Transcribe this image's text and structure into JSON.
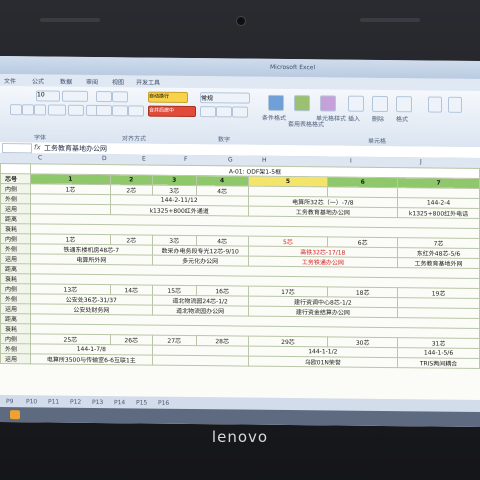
{
  "window_title": "Microsoft Excel",
  "menu": [
    "文件",
    "公式",
    "数据",
    "审阅",
    "视图",
    "开发工具"
  ],
  "ribbon": {
    "groups": [
      "字体",
      "对齐方式",
      "数字",
      "单元格"
    ],
    "font_size": "10",
    "number_format": "常规",
    "wrap_button": "自动换行",
    "merge_button": "合并后居中",
    "buttons": [
      "条件格式",
      "套用表格格式",
      "单元格样式",
      "插入",
      "删除",
      "格式"
    ]
  },
  "formula_bar": {
    "fx": "fx",
    "content": "工务教育基地办公网"
  },
  "columns": [
    "C",
    "D",
    "E",
    "F",
    "G",
    "H",
    "I",
    "J"
  ],
  "table": {
    "title": "A-01: ODF架1-5框",
    "header_label": "芯号",
    "header_nums": [
      "1",
      "2",
      "3",
      "4",
      "5",
      "6",
      "7"
    ],
    "blocks": [
      {
        "row_labels": [
          "内侧",
          "外侧",
          "运用",
          "距离",
          "衰耗"
        ],
        "inner": [
          "1芯",
          "2芯",
          "3芯",
          "4芯",
          "",
          "",
          ""
        ],
        "outer": [
          "144-2-11/12",
          "电算所32芯（一）-7/8",
          "144-2-4"
        ],
        "use": [
          "k1325+800红外通道",
          "工务教育基地办公网",
          "k1325+800红外电话"
        ]
      },
      {
        "row_labels": [
          "内侧",
          "外侧",
          "运用",
          "距离",
          "衰耗"
        ],
        "inner": [
          "1芯",
          "2芯",
          "3芯",
          "4芯",
          "5芯",
          "6芯",
          "7芯"
        ],
        "outer": [
          "铁通东楼机房48芯-7",
          "数采办电务段专光12芯-9/10",
          "高铁32芯-17/18",
          "东红外48芯-5/6"
        ],
        "use": [
          "电算所外网",
          "多元化办公网",
          "工务铁通办公网",
          "工务教育基地外网"
        ]
      },
      {
        "row_labels": [
          "内侧",
          "外侧",
          "运用",
          "距离",
          "衰耗"
        ],
        "inner": [
          "13芯",
          "14芯",
          "15芯",
          "16芯",
          "17芯",
          "18芯",
          "19芯"
        ],
        "outer": [
          "公安处36芯-31/37",
          "道北物流园24芯-1/2",
          "建行资调中心8芯-1/2"
        ],
        "use": [
          "公安处财务网",
          "道北物流园办公网",
          "建行资金结算办公网"
        ]
      },
      {
        "row_labels": [
          "内侧",
          "外侧",
          "运用"
        ],
        "inner": [
          "25芯",
          "26芯",
          "27芯",
          "28芯",
          "29芯",
          "30芯",
          "31芯"
        ],
        "outer": [
          "144-1-7/8",
          "144-1-1/2",
          "144-1-5/6"
        ],
        "use": [
          "电算所3500与传输室6-6互联1主",
          "乌欧01N荣誉",
          "TRIS两间耦合"
        ]
      }
    ]
  },
  "sheet_tabs": [
    "P9",
    "P10",
    "P11",
    "P12",
    "P13",
    "P14",
    "P15",
    "P16"
  ],
  "brand_logo": "lenovo"
}
